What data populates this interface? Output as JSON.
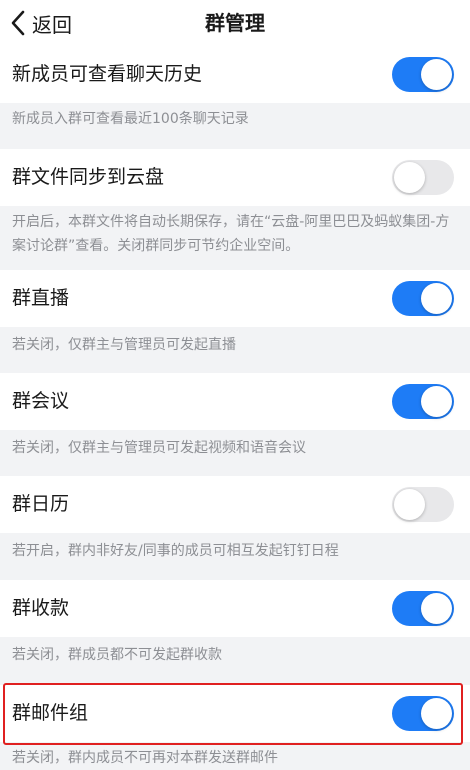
{
  "nav": {
    "back_label": "返回",
    "title": "群管理",
    "back_icon": "chevron-left-icon"
  },
  "settings": [
    {
      "label": "新成员可查看聊天历史",
      "enabled": true,
      "description": "新成员入群可查看最近100条聊天记录"
    },
    {
      "label": "群文件同步到云盘",
      "enabled": false,
      "description": "开启后，本群文件将自动长期保存，请在“云盘-阿里巴巴及蚂蚁集团-方案讨论群”查看。关闭群同步可节约企业空间。"
    },
    {
      "label": "群直播",
      "enabled": true,
      "description": "若关闭，仅群主与管理员可发起直播"
    },
    {
      "label": "群会议",
      "enabled": true,
      "description": "若关闭，仅群主与管理员可发起视频和语音会议"
    },
    {
      "label": "群日历",
      "enabled": false,
      "description": "若开启，群内非好友/同事的成员可相互发起钉钉日程"
    },
    {
      "label": "群收款",
      "enabled": true,
      "description": "若关闭，群成员都不可发起群收款"
    },
    {
      "label": "群邮件组",
      "enabled": true,
      "description": "若关闭，群内成员不可再对本群发送群邮件"
    }
  ],
  "colors": {
    "toggle_on": "#1e7cf6",
    "toggle_off": "#e8e8ea",
    "highlight": "#e02020",
    "background": "#f2f3f5"
  }
}
